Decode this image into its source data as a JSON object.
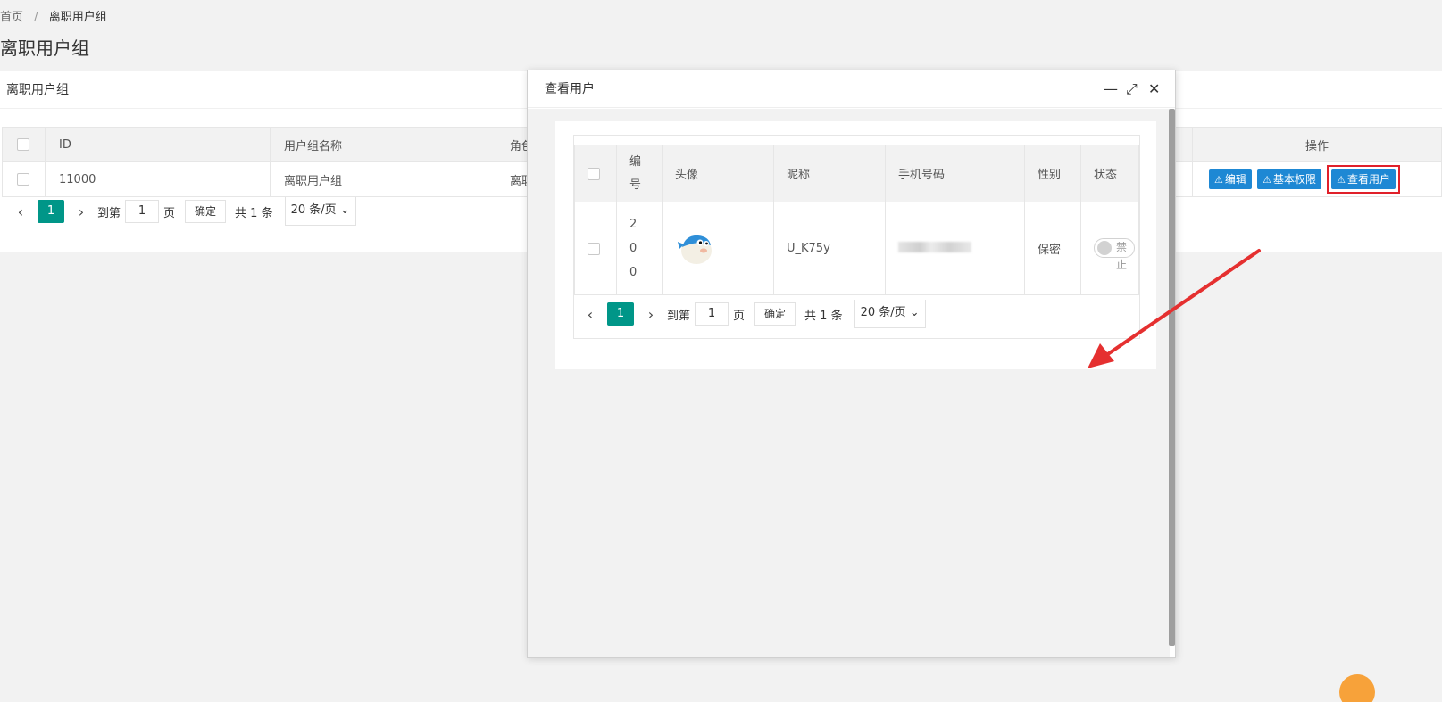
{
  "breadcrumb": {
    "home": "首页",
    "sep": "/",
    "current": "离职用户组"
  },
  "page_title": "离职用户组",
  "card": {
    "title": "离职用户组"
  },
  "main_table": {
    "headers": {
      "id": "ID",
      "name": "用户组名称",
      "role": "角色",
      "ops": "操作"
    },
    "row": {
      "id": "11000",
      "name": "离职用户组",
      "role": "离职"
    },
    "actions": {
      "edit": "编辑",
      "perm": "基本权限",
      "view": "查看用户"
    }
  },
  "pager": {
    "prev": "‹",
    "next": "›",
    "page": "1",
    "goto": "到第",
    "input": "1",
    "page_unit": "页",
    "confirm": "确定",
    "total": "共 1 条",
    "size": "20 条/页"
  },
  "modal": {
    "title": "查看用户",
    "headers": {
      "no": "编号",
      "avatar": "头像",
      "nick": "昵称",
      "phone": "手机号码",
      "gender": "性别",
      "status": "状态"
    },
    "row": {
      "no": "200",
      "nick": "U_K75y",
      "gender": "保密",
      "status": "禁止"
    }
  },
  "colors": {
    "accent": "#009688",
    "button": "#1e88d4",
    "highlight": "#e0202a"
  }
}
